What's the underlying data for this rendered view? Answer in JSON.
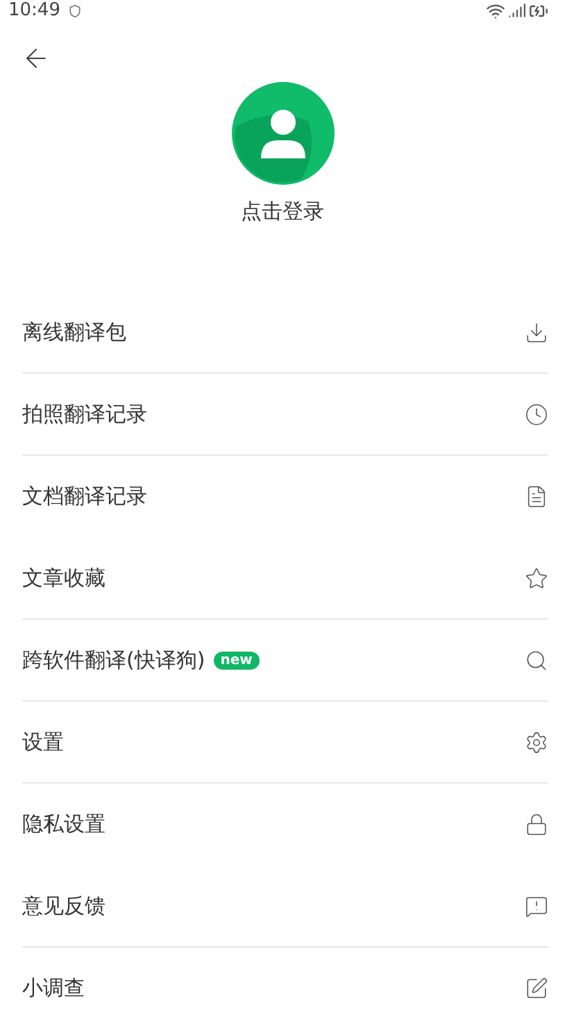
{
  "status_bar": {
    "time": "10:49"
  },
  "profile": {
    "login_label": "点击登录"
  },
  "menu": [
    {
      "label": "离线翻译包",
      "kind": "download",
      "divider": true
    },
    {
      "label": "拍照翻译记录",
      "kind": "clock",
      "divider": true
    },
    {
      "label": "文档翻译记录",
      "kind": "document",
      "divider": false
    },
    {
      "label": "文章收藏",
      "kind": "star",
      "divider": true
    },
    {
      "label": "跨软件翻译(快译狗)",
      "badge": "new",
      "kind": "search",
      "divider": true
    },
    {
      "label": "设置",
      "kind": "settings",
      "divider": true
    },
    {
      "label": "隐私设置",
      "kind": "lock",
      "divider": false
    },
    {
      "label": "意见反馈",
      "kind": "feedback",
      "divider": true
    },
    {
      "label": "小调查",
      "kind": "edit"
    }
  ]
}
